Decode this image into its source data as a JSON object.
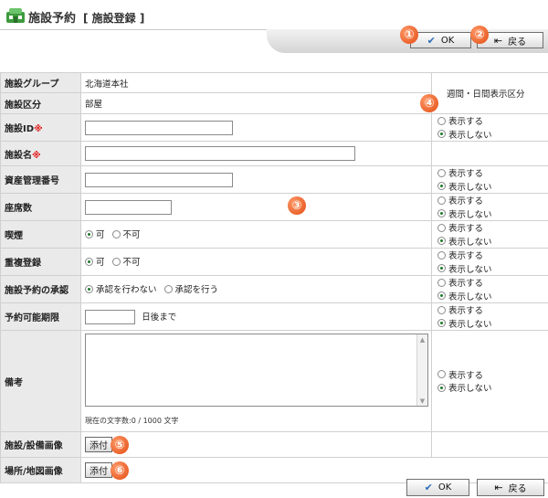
{
  "header": {
    "title": "施設予約",
    "subtitle": "[ 施設登録 ]",
    "logo_icon": "facility-icon"
  },
  "buttons": {
    "ok": "OK",
    "back": "戻る"
  },
  "markers": [
    "①",
    "②",
    "③",
    "④",
    "⑤",
    "⑥"
  ],
  "visibility_header": "週間・日間表示区分",
  "visibility_options": {
    "show": "表示する",
    "hide": "表示しない"
  },
  "rows": {
    "group": {
      "label": "施設グループ",
      "value": "北海道本社"
    },
    "category": {
      "label": "施設区分",
      "value": "部屋"
    },
    "facility_id": {
      "label": "施設ID",
      "required_mark": "※"
    },
    "facility_name": {
      "label": "施設名",
      "required_mark": "※"
    },
    "asset_no": {
      "label": "資産管理番号"
    },
    "seats": {
      "label": "座席数"
    },
    "smoking": {
      "label": "喫煙",
      "options": [
        "可",
        "不可"
      ],
      "selected": "可"
    },
    "double_booking": {
      "label": "重複登録",
      "options": [
        "可",
        "不可"
      ],
      "selected": "可"
    },
    "approval": {
      "label": "施設予約の承認",
      "options": [
        "承認を行わない",
        "承認を行う"
      ],
      "selected": "承認を行わない"
    },
    "period": {
      "label": "予約可能期限",
      "suffix": "日後まで"
    },
    "note": {
      "label": "備考",
      "counter": "現在の文字数:0 / 1000 文字"
    },
    "facility_image": {
      "label": "施設/設備画像",
      "button": "添付"
    },
    "map_image": {
      "label": "場所/地図画像",
      "button": "添付"
    }
  },
  "accent_colors": {
    "marker": "#e24b10",
    "required": "#e02020",
    "selected_radio": "#1e7a2a"
  }
}
